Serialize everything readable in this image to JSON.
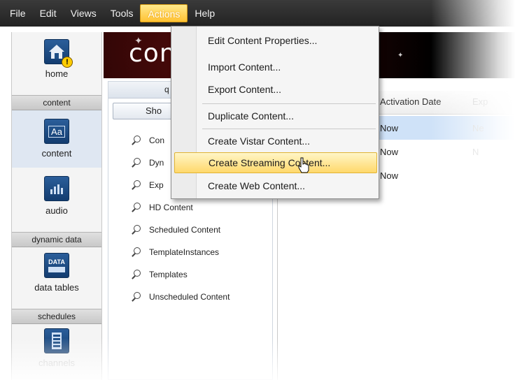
{
  "menubar": {
    "items": [
      {
        "label": "File",
        "underline_index": 0
      },
      {
        "label": "Edit",
        "underline_index": 0
      },
      {
        "label": "Views",
        "underline_index": 0
      },
      {
        "label": "Tools",
        "underline_index": 0
      },
      {
        "label": "Actions",
        "underline_index": 0
      },
      {
        "label": "Help",
        "underline_index": 0
      }
    ],
    "active": "Actions"
  },
  "actions_menu": {
    "items": [
      {
        "label": "Edit Content Properties..."
      },
      {
        "label": "Import Content..."
      },
      {
        "label": "Export Content..."
      },
      {
        "label": "Duplicate Content..."
      },
      {
        "label": "Create Vistar Content..."
      },
      {
        "label": "Create Streaming Content..."
      },
      {
        "label": "Create Web Content..."
      }
    ],
    "hovered": "Create Streaming Content..."
  },
  "leftnav": {
    "home": {
      "label": "home",
      "icon": "home-icon"
    },
    "section_content": "content",
    "content": {
      "label": "content",
      "icon": "content-aa-icon"
    },
    "audio": {
      "label": "audio",
      "icon": "audio-icon"
    },
    "section_dynamic": "dynamic data",
    "data_tables": {
      "label": "data tables",
      "icon": "data-table-icon",
      "icon_text": "DATA"
    },
    "section_schedules": "schedules",
    "channels": {
      "label": "channels",
      "icon": "channel-icon"
    }
  },
  "banner": {
    "title": "con"
  },
  "query_panel": {
    "header": "q",
    "show_button": "Sho",
    "items": [
      "Con",
      "Dyn",
      "Exp",
      "HD Content",
      "Scheduled Content",
      "TemplateInstances",
      "Templates",
      "Unscheduled Content"
    ]
  },
  "grid": {
    "columns": [
      "Activation Date",
      "Exp"
    ],
    "rows": [
      {
        "activation": "Now",
        "exp": "Ne",
        "selected": true
      },
      {
        "activation": "Now",
        "exp": "N",
        "selected": false
      },
      {
        "activation": "Now",
        "exp": "",
        "selected": false
      }
    ]
  },
  "icon_text": {
    "content": "Aa"
  },
  "colors": {
    "menubar": "#2b2b2b",
    "highlight": "#ffd86b",
    "selection": "#cfe2f8",
    "nav_icon": "#1f4f87"
  }
}
